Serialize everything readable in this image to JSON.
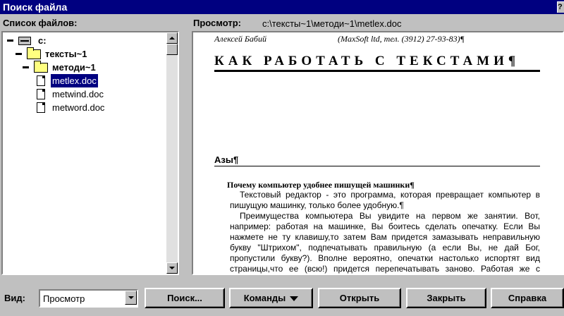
{
  "window": {
    "title": "Поиск файла"
  },
  "labels": {
    "file_list": "Список файлов:",
    "preview": "Просмотр:",
    "preview_path": "c:\\тексты~1\\методи~1\\metlex.doc",
    "view": "Вид:"
  },
  "tree": {
    "items": [
      {
        "label": "c:",
        "type": "drive",
        "level": 0,
        "selected": false
      },
      {
        "label": "тексты~1",
        "type": "folder",
        "level": 1,
        "selected": false
      },
      {
        "label": "методи~1",
        "type": "folder",
        "level": 2,
        "selected": false
      },
      {
        "label": "metlex.doc",
        "type": "doc",
        "level": 3,
        "selected": true
      },
      {
        "label": "metwind.doc",
        "type": "doc",
        "level": 3,
        "selected": false
      },
      {
        "label": "metword.doc",
        "type": "doc",
        "level": 3,
        "selected": false
      }
    ]
  },
  "preview": {
    "author": "Алексей Бабий",
    "company": "(MaxSoft ltd, тел. (3912) 27-93-83)¶",
    "title": "КАК РАБОТАТЬ С ТЕКСТАМИ¶",
    "section": "Азы¶",
    "question": "Почему компьютер удобнее пишущей машинки¶",
    "para1": "Текстовый редактор - это программа, которая превращает компьютер в пишущую машинку, только более удобную.¶",
    "para2": "Преимущества компьютера Вы увидите на первом же занятии. Вот, например: работая на машинке, Вы боитесь сделать опечатку. Если Вы нажмете не ту клавишу,то затем Вам придется замазывать неправильную букву \"Штрихом\", подпечатывать правильную (а если Вы, не дай Бог, пропустили букву?). Вполне вероятно, опечатки настолько испортят вид страницы,что ее (всю!) придется перепечатывать заново. Работая же с компьютером, Вы всего-навсего, заметив опечатку, подводите к нужному"
  },
  "view_select": {
    "value": "Просмотр"
  },
  "buttons": {
    "search": "Поиск...",
    "commands": "Команды",
    "open": "Открыть",
    "close": "Закрыть",
    "help": "Справка"
  }
}
